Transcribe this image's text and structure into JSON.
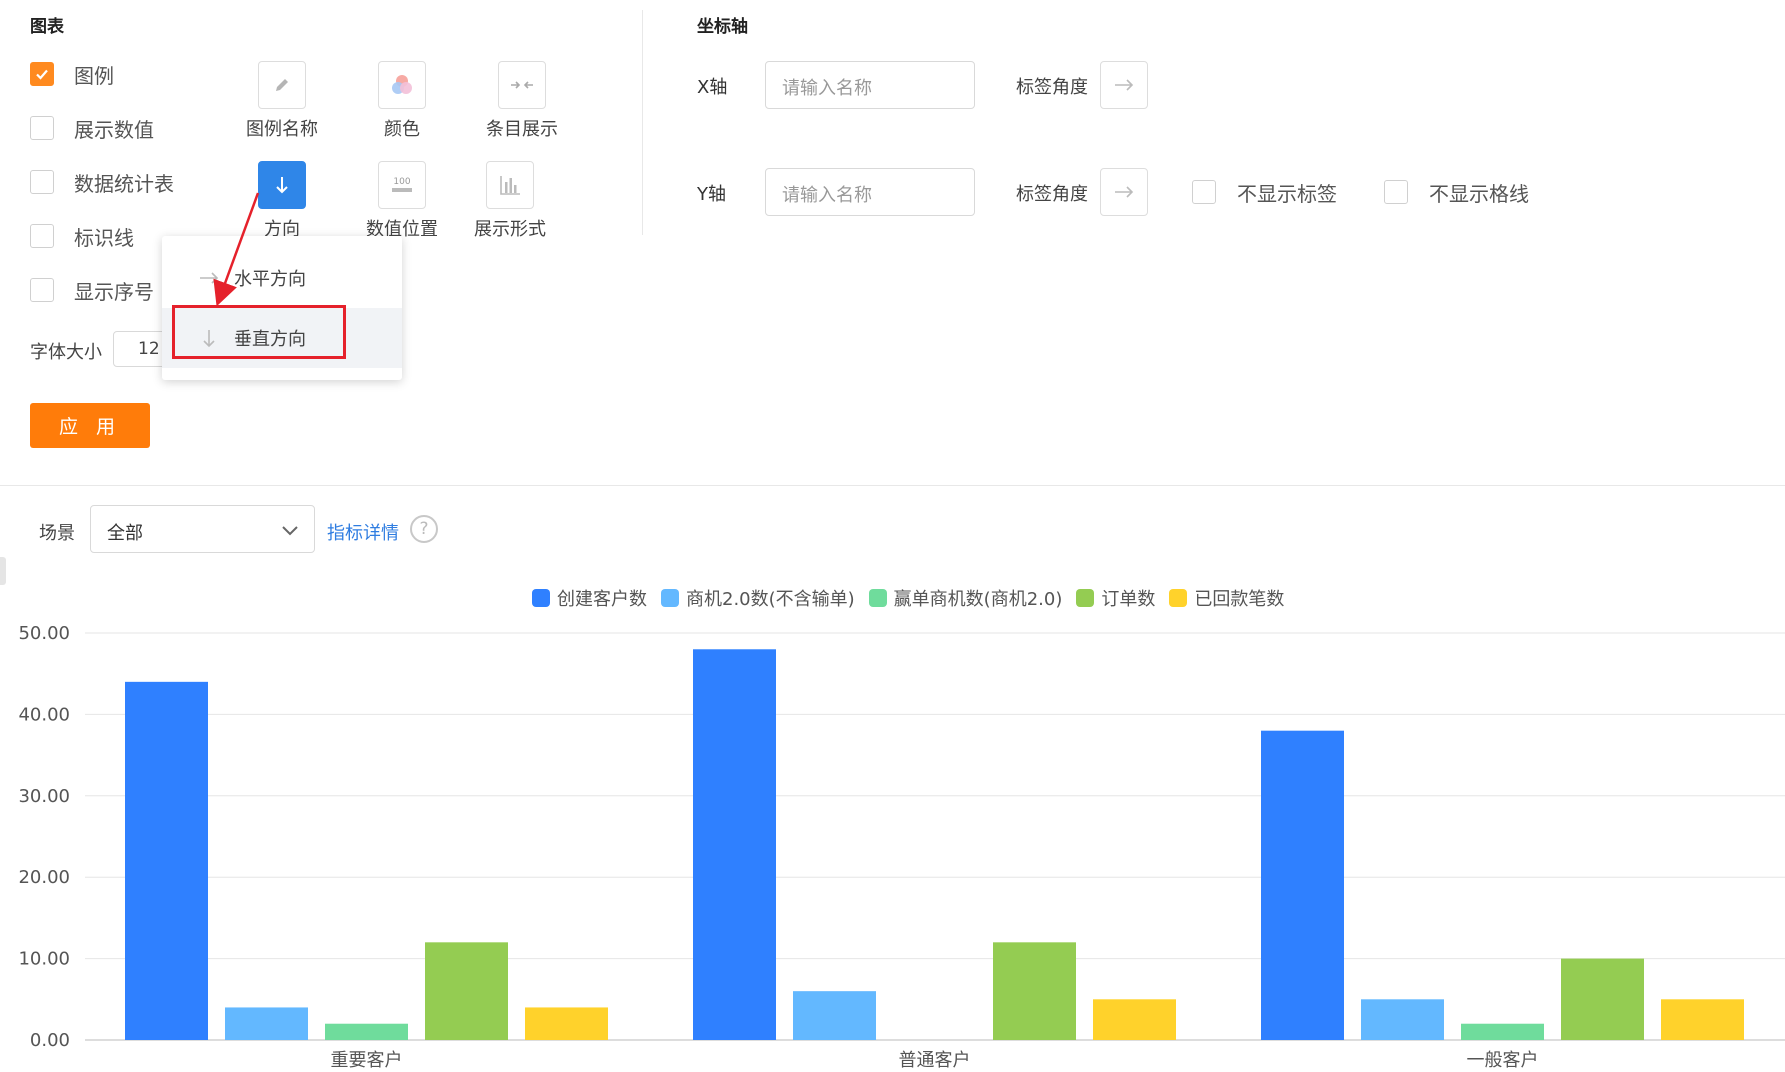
{
  "chart_panel": {
    "title": "图表",
    "options": [
      {
        "label": "图例",
        "checked": true
      },
      {
        "label": "展示数值",
        "checked": false
      },
      {
        "label": "数据统计表",
        "checked": false
      },
      {
        "label": "标识线",
        "checked": false
      },
      {
        "label": "显示序号",
        "checked": false
      }
    ],
    "tools": [
      {
        "label": "图例名称",
        "icon": "pencil-icon"
      },
      {
        "label": "颜色",
        "icon": "color-palette-icon"
      },
      {
        "label": "条目展示",
        "icon": "arrows-in-icon"
      },
      {
        "label": "方向",
        "icon": "arrow-down-icon"
      },
      {
        "label": "数值位置",
        "icon": "value-position-icon"
      },
      {
        "label": "展示形式",
        "icon": "bar-chart-icon"
      }
    ],
    "font_size_label": "字体大小",
    "font_size_value": "12",
    "apply_label": "应 用"
  },
  "direction_dropdown": {
    "items": [
      {
        "label": "水平方向",
        "icon": "arrow-right-icon"
      },
      {
        "label": "垂直方向",
        "icon": "arrow-down-icon",
        "selected": true
      }
    ]
  },
  "axis_panel": {
    "title": "坐标轴",
    "x_label": "X轴",
    "y_label": "Y轴",
    "name_placeholder": "请输入名称",
    "angle_label": "标签角度",
    "hide_labels": "不显示标签",
    "hide_grid": "不显示格线"
  },
  "toolbar": {
    "scene_label": "场景",
    "scene_value": "全部",
    "metric_link": "指标详情",
    "help": "?"
  },
  "colors": {
    "accent": "#ff7c0a",
    "active_tool": "#2f86e8",
    "annotation": "#e5212b"
  },
  "chart_data": {
    "type": "bar",
    "categories": [
      "重要客户",
      "普通客户",
      "一般客户"
    ],
    "series": [
      {
        "name": "创建客户数",
        "color": "#2f80ff",
        "values": [
          44,
          48,
          38
        ]
      },
      {
        "name": "商机2.0数(不含输单)",
        "color": "#63b8ff",
        "values": [
          4,
          6,
          5
        ]
      },
      {
        "name": "赢单商机数(商机2.0)",
        "color": "#6fdc9c",
        "values": [
          2,
          0,
          2
        ]
      },
      {
        "name": "订单数",
        "color": "#94cc52",
        "values": [
          12,
          12,
          10
        ]
      },
      {
        "name": "已回款笔数",
        "color": "#ffd22b",
        "values": [
          4,
          5,
          5
        ]
      }
    ],
    "yticks": [
      "0.00",
      "10.00",
      "20.00",
      "30.00",
      "40.00",
      "50.00"
    ],
    "ylim": [
      0,
      50
    ],
    "grid": true,
    "legend_position": "top-center"
  }
}
